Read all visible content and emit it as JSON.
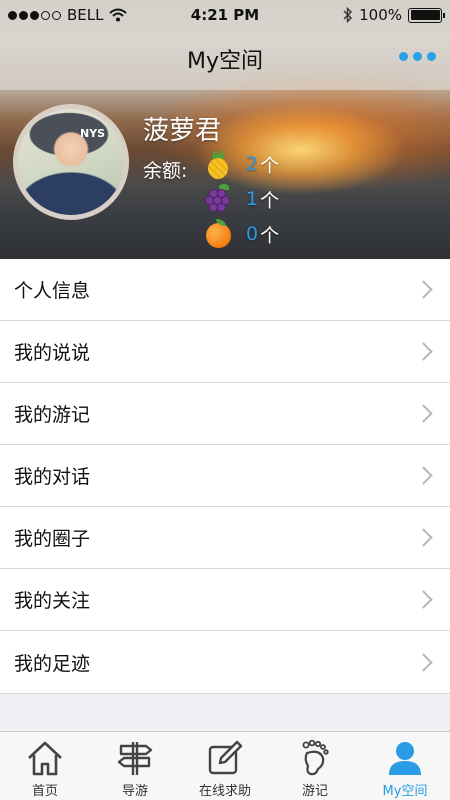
{
  "status_bar": {
    "carrier": "BELL",
    "time": "4:21 PM",
    "battery": "100%"
  },
  "nav": {
    "title": "My空间",
    "more_icon": "more-dots-icon",
    "accent_color": "#2aa0e8"
  },
  "profile": {
    "avatar_icon": "avatar",
    "avatar_cap_text": "NYS",
    "username": "菠萝君",
    "balance_label": "余额:",
    "balances": [
      {
        "fruit": "pineapple-icon",
        "count": "2",
        "unit": "个"
      },
      {
        "fruit": "grapes-icon",
        "count": "1",
        "unit": "个"
      },
      {
        "fruit": "orange-icon",
        "count": "0",
        "unit": "个"
      }
    ]
  },
  "menu": {
    "items": [
      {
        "label": "个人信息"
      },
      {
        "label": "我的说说"
      },
      {
        "label": "我的游记"
      },
      {
        "label": "我的对话"
      },
      {
        "label": "我的圈子"
      },
      {
        "label": "我的关注"
      },
      {
        "label": "我的足迹"
      }
    ]
  },
  "tab_bar": {
    "tabs": [
      {
        "label": "首页",
        "icon": "home-icon",
        "active": false
      },
      {
        "label": "导游",
        "icon": "signpost-icon",
        "active": false
      },
      {
        "label": "在线求助",
        "icon": "edit-icon",
        "active": false
      },
      {
        "label": "游记",
        "icon": "footprint-icon",
        "active": false
      },
      {
        "label": "My空间",
        "icon": "user-icon",
        "active": true
      }
    ],
    "active_color": "#2a9ce6"
  }
}
